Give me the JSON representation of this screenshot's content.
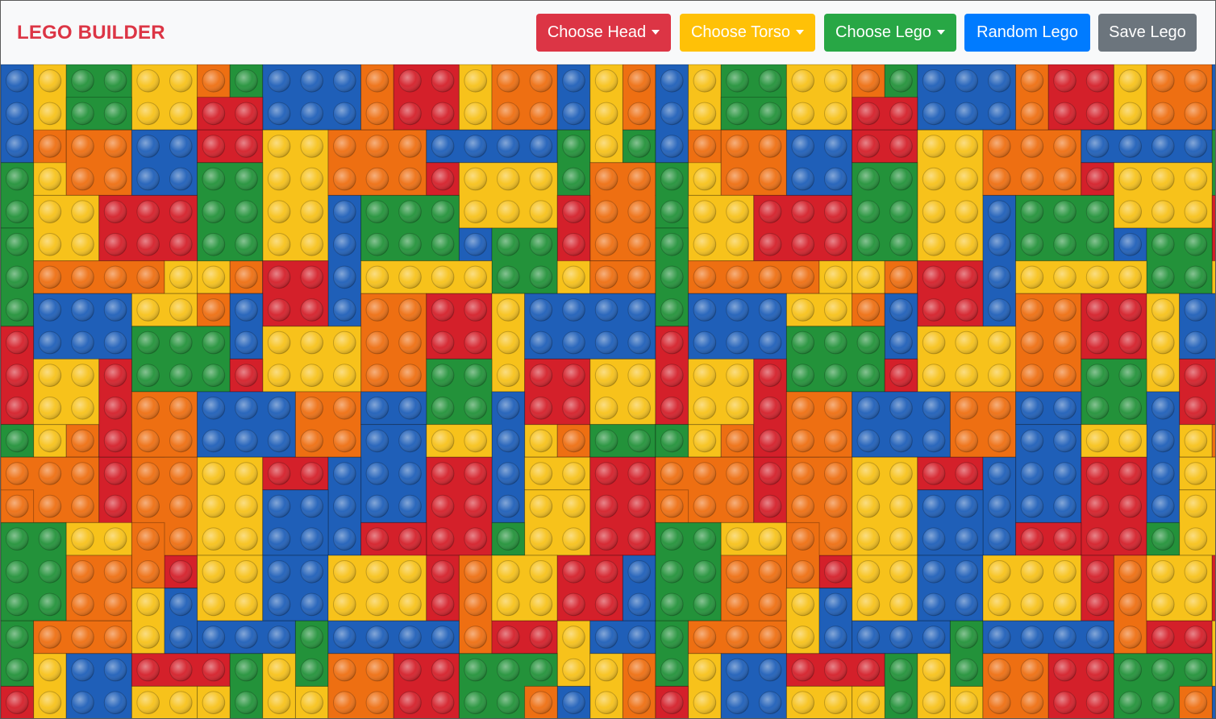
{
  "navbar": {
    "brand": "LEGO BUILDER",
    "buttons": {
      "choose_head": "Choose Head",
      "choose_torso": "Choose Torso",
      "choose_lego": "Choose Lego",
      "random_lego": "Random Lego",
      "save_lego": "Save Lego"
    },
    "colors": {
      "brand": "#dc3545",
      "choose_head": "#dc3545",
      "choose_torso": "#ffc107",
      "choose_lego": "#28a745",
      "random_lego": "#007bff",
      "save_lego": "#6c757d"
    }
  },
  "background": {
    "image": "lego-bricks-pattern",
    "brick_colors": [
      "#d4202a",
      "#f7c21b",
      "#1f5fb8",
      "#23923a",
      "#ee6f12"
    ]
  }
}
